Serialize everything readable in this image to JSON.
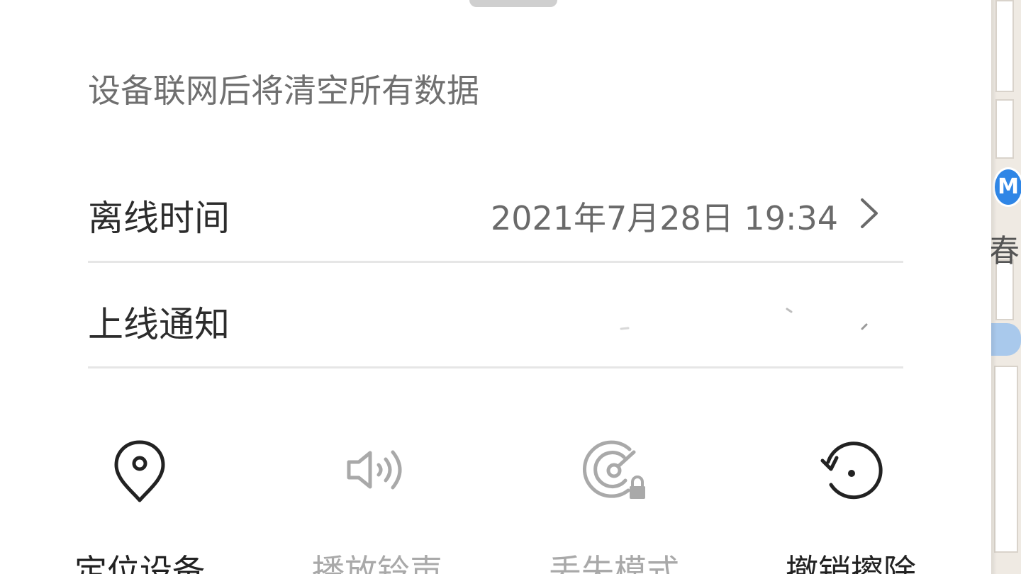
{
  "sheet": {
    "notice": "设备联网后将清空所有数据"
  },
  "rows": {
    "offline_time": {
      "label": "离线时间",
      "value": "2021年7月28日 19:34"
    },
    "online_notify": {
      "label": "上线通知"
    }
  },
  "actions": [
    {
      "label": "定位设备",
      "icon": "location-pin-icon",
      "enabled": true
    },
    {
      "label": "播放铃声",
      "icon": "speaker-icon",
      "enabled": false
    },
    {
      "label": "丢失模式",
      "icon": "radar-lock-icon",
      "enabled": false
    },
    {
      "label": "撤销擦除",
      "icon": "undo-erase-icon",
      "enabled": true
    }
  ],
  "map": {
    "place_text": "春花",
    "metro_badge": "M"
  },
  "colors": {
    "enabled_icon": "#222222",
    "disabled_icon": "#a9a9a9",
    "metro_blue": "#2f86e6"
  }
}
